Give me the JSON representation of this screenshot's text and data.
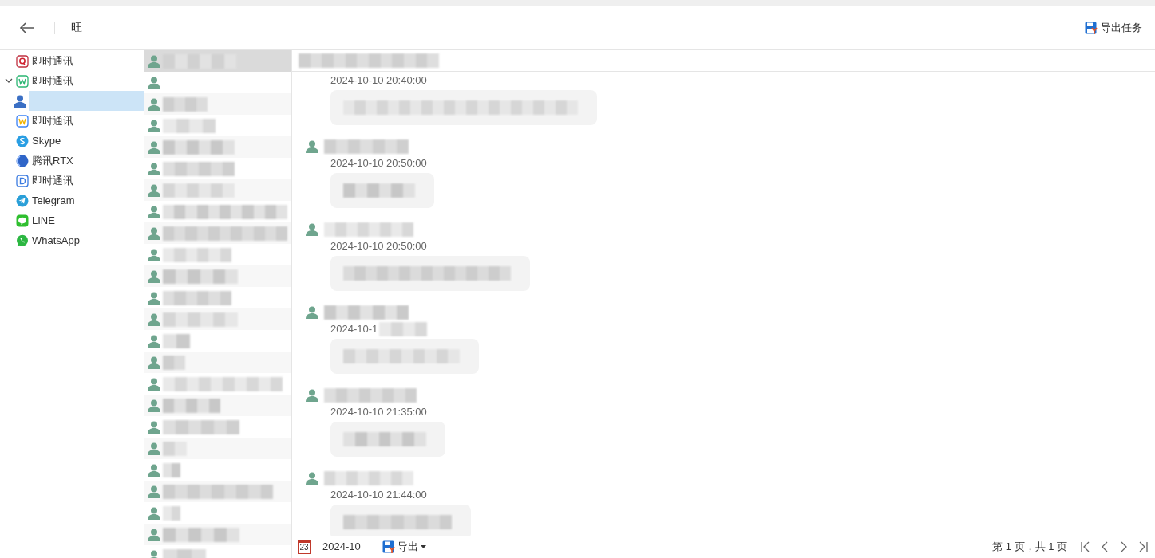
{
  "header": {
    "title": "旺",
    "export_task": "导出任务"
  },
  "platforms": [
    {
      "kind": "q-app",
      "label": "即时通讯",
      "expanded": false
    },
    {
      "kind": "w-green",
      "label": "即时通讯",
      "expanded": true,
      "children": [
        {
          "kind": "contact",
          "selected": true
        }
      ]
    },
    {
      "kind": "w-yellow",
      "label": "即时通讯",
      "expanded": false
    },
    {
      "kind": "skype",
      "label": "Skype",
      "expanded": false
    },
    {
      "kind": "rtx",
      "label": "腾讯RTX",
      "expanded": false
    },
    {
      "kind": "d-app",
      "label": "即时通讯",
      "expanded": false
    },
    {
      "kind": "telegram",
      "label": "Telegram",
      "expanded": false
    },
    {
      "kind": "line",
      "label": "LINE",
      "expanded": false
    },
    {
      "kind": "whatsapp",
      "label": "WhatsApp",
      "expanded": false
    }
  ],
  "contacts": [
    {
      "selected": true
    },
    {
      "selected": false
    },
    {
      "selected": false
    },
    {
      "selected": false
    },
    {
      "selected": false
    },
    {
      "selected": false
    },
    {
      "selected": false
    },
    {
      "selected": false
    },
    {
      "selected": false
    },
    {
      "selected": false
    },
    {
      "selected": false
    },
    {
      "selected": false
    },
    {
      "selected": false
    },
    {
      "selected": false
    },
    {
      "selected": false
    },
    {
      "selected": false
    },
    {
      "selected": false
    },
    {
      "selected": false
    },
    {
      "selected": false
    },
    {
      "selected": false
    },
    {
      "selected": false
    },
    {
      "selected": false
    },
    {
      "selected": false
    },
    {
      "selected": false
    }
  ],
  "messages": [
    {
      "time": "2024-10-10 20:40:00",
      "sender_shown": false
    },
    {
      "time": "2024-10-10 20:50:00",
      "sender_shown": true
    },
    {
      "time": "2024-10-10 20:50:00",
      "sender_shown": true
    },
    {
      "time": "2024-10-1",
      "sender_shown": true,
      "time_blurred": true
    },
    {
      "time": "2024-10-10 21:35:00",
      "sender_shown": true
    },
    {
      "time": "2024-10-10 21:44:00",
      "sender_shown": true
    }
  ],
  "footer": {
    "calendar_day": "23",
    "month": "2024-10",
    "export": "导出",
    "paging": "第 1 页，共 1 页"
  }
}
